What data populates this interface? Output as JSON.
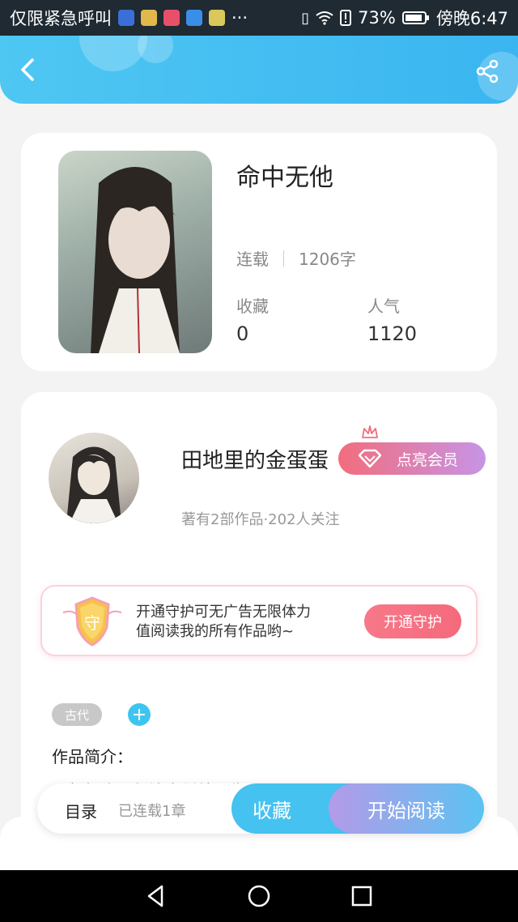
{
  "status_bar": {
    "carrier_text": "仅限紧急呼叫",
    "more": "···",
    "battery_percent": "73%",
    "time": "傍晚6:47"
  },
  "book": {
    "title": "命中无他",
    "status": "连载",
    "word_count": "1206字",
    "stats": [
      {
        "label": "收藏",
        "value": "0"
      },
      {
        "label": "人气",
        "value": "1120"
      }
    ]
  },
  "author": {
    "name": "田地里的金蛋蛋",
    "meta": "著有2部作品·202人关注",
    "vip_label": "点亮会员"
  },
  "guard": {
    "text_line1": "开通守护可无广告无限体力",
    "text_line2": "值阅读我的所有作品哟~",
    "button_label": "开通守护",
    "shield_char": "守"
  },
  "tags": [
    "古代"
  ],
  "intro": {
    "label": "作品简介：",
    "text": "一朝相逢，便注定纠缠一生"
  },
  "action_bar": {
    "toc_label": "目录",
    "toc_status": "已连载1章",
    "collect_label": "收藏",
    "read_label": "开始阅读"
  },
  "colors": {
    "header": "#3ab5f0",
    "accent_blue": "#45c2ef",
    "accent_pink": "#f46a7c",
    "vip_gradient_end": "#c794e6"
  }
}
